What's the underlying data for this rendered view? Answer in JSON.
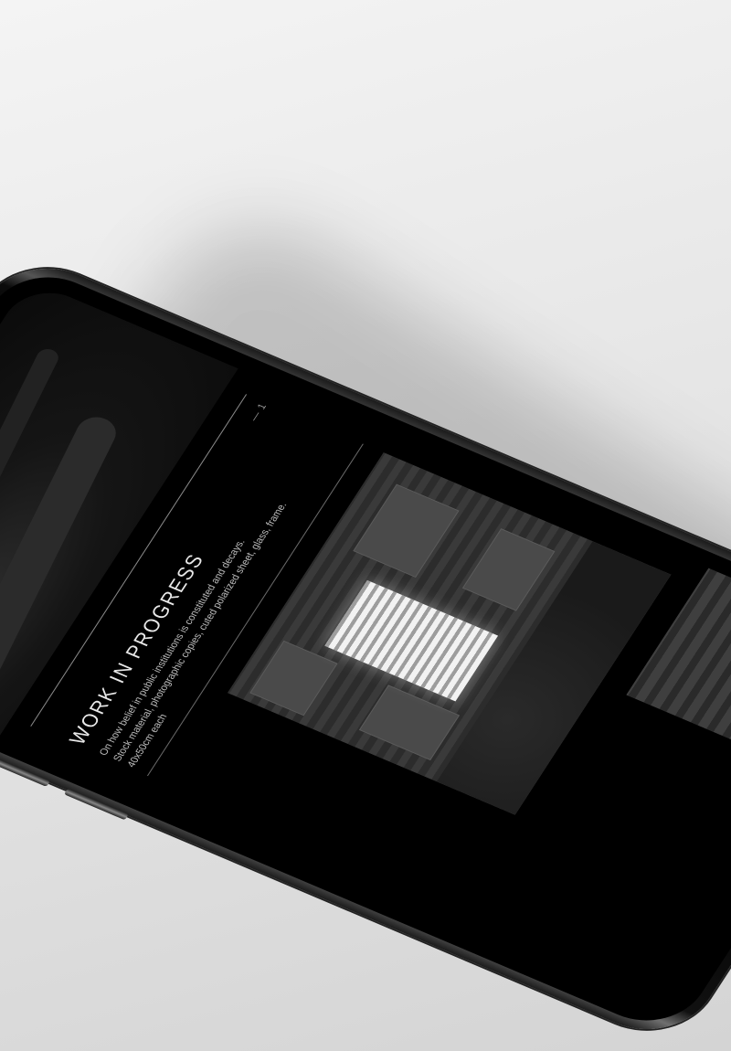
{
  "project": {
    "title": "WORK IN PROGRESS",
    "counter": "— 1",
    "description": [
      "On how belief in public institutions is constituted and decays.",
      "Stock material, photographic copies, cuted polarized sheet, glass, frame.",
      "40x50cm each"
    ]
  },
  "colors": {
    "background": "#e6e6e6",
    "screen": "#000000",
    "text": "#e8e8e8",
    "camera_lens": "#4a5ad8"
  }
}
